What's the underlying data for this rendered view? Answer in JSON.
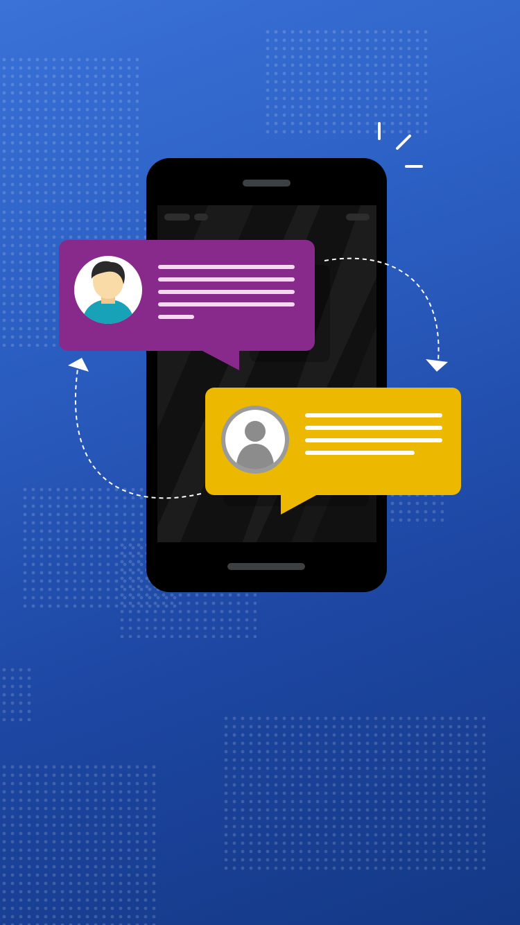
{
  "scene": {
    "description_icons": [
      "phone-icon",
      "chat-bubble-icon",
      "user-avatar-icon",
      "placeholder-avatar-icon",
      "exchange-arrow-icon"
    ]
  },
  "colors": {
    "background_top": "#3a72d8",
    "background_bottom": "#143885",
    "phone_body": "#000000",
    "phone_screen": "#111111",
    "bubble_left": "#872a8b",
    "bubble_right": "#edb900",
    "text_lines_left": "#f6d9f0",
    "text_lines_right": "#ffffff",
    "avatar_shirt": "#18a2b8",
    "avatar_skin": "#f9dba8",
    "avatar_hair": "#2b2b2b",
    "placeholder_avatar": "#8c8c8c"
  },
  "chat": {
    "messages": [
      {
        "sender": "user",
        "line_count": 5
      },
      {
        "sender": "contact",
        "line_count": 4
      }
    ]
  }
}
